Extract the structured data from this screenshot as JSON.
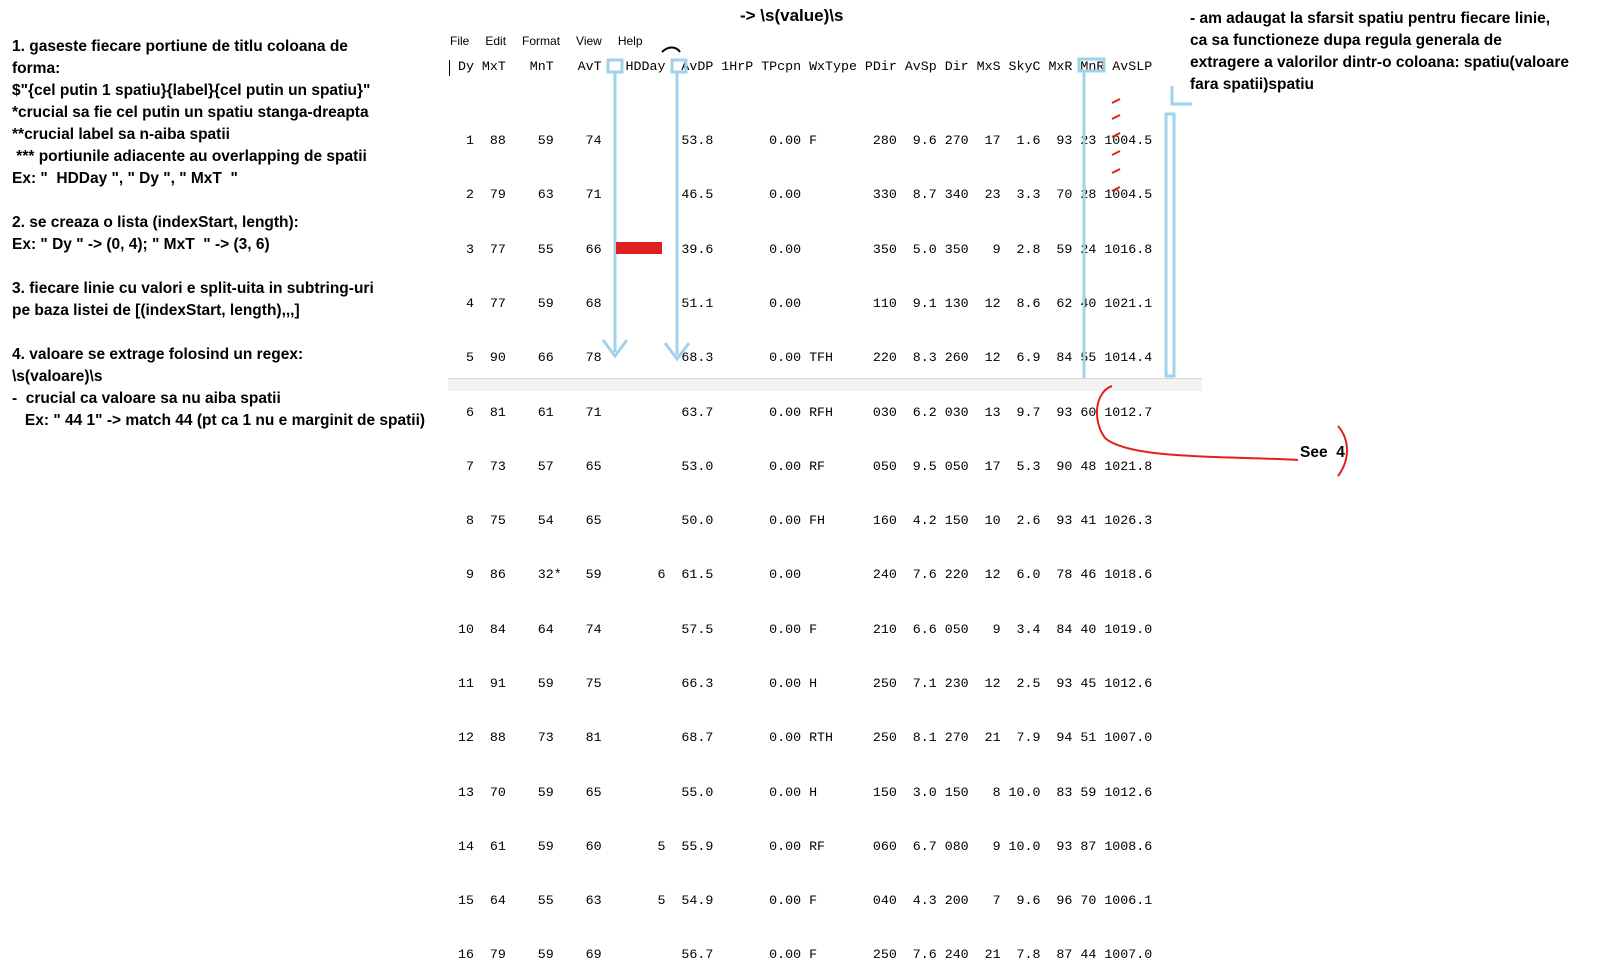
{
  "title_top": "-> \\s(value)\\s",
  "left_notes": [
    "1. gaseste fiecare portiune de titlu coloana de",
    "forma:",
    "$\"{cel putin 1 spatiu}{label}{cel putin un spatiu}\"",
    "*crucial sa fie cel putin un spatiu stanga-dreapta",
    "**crucial label sa n-aiba spatii",
    " *** portiunile adiacente au overlapping de spatii",
    "Ex: \"  HDDay \", \" Dy \", \" MxT  \"",
    "",
    "2. se creaza o lista (indexStart, length):",
    "Ex: \" Dy \" -> (0, 4); \" MxT  \" -> (3, 6)",
    "",
    "3. fiecare linie cu valori e split-uita in subtring-uri",
    "pe baza listei de [(indexStart, length),,,]",
    "",
    "4. valoare se extrage folosind un regex:",
    "\\s(valoare)\\s",
    "-  crucial ca valoare sa nu aiba spatii",
    "   Ex: \" 44 1\" -> match 44 (pt ca 1 nu e marginit de spatii)"
  ],
  "right_note": " - am adaugat la sfarsit spatiu pentru fiecare linie, ca sa functioneze dupa regula generala de extragere a valorilor dintr-o coloana: spatiu(valoare fara spatii)spatiu",
  "see_label": "See  4",
  "menu": [
    "File",
    "Edit",
    "Format",
    "View",
    "Help"
  ],
  "header_line": " Dy MxT   MnT   AvT   HDDay  AvDP 1HrP TPcpn WxType PDir AvSp Dir MxS SkyC MxR MnR AvSLP",
  "rows": [
    "  1  88    59    74          53.8       0.00 F       280  9.6 270  17  1.6  93 23 1004.5",
    "  2  79    63    71          46.5       0.00         330  8.7 340  23  3.3  70 28 1004.5",
    "  3  77    55    66          39.6       0.00         350  5.0 350   9  2.8  59 24 1016.8",
    "  4  77    59    68          51.1       0.00         110  9.1 130  12  8.6  62 40 1021.1",
    "  5  90    66    78          68.3       0.00 TFH     220  8.3 260  12  6.9  84 55 1014.4",
    "  6  81    61    71          63.7       0.00 RFH     030  6.2 030  13  9.7  93 60 1012.7",
    "  7  73    57    65          53.0       0.00 RF      050  9.5 050  17  5.3  90 48 1021.8",
    "  8  75    54    65          50.0       0.00 FH      160  4.2 150  10  2.6  93 41 1026.3",
    "  9  86    32*   59       6  61.5       0.00         240  7.6 220  12  6.0  78 46 1018.6",
    " 10  84    64    74          57.5       0.00 F       210  6.6 050   9  3.4  84 40 1019.0",
    " 11  91    59    75          66.3       0.00 H       250  7.1 230  12  2.5  93 45 1012.6",
    " 12  88    73    81          68.7       0.00 RTH     250  8.1 270  21  7.9  94 51 1007.0",
    " 13  70    59    65          55.0       0.00 H       150  3.0 150   8 10.0  83 59 1012.6",
    " 14  61    59    60       5  55.9       0.00 RF      060  6.7 080   9 10.0  93 87 1008.6",
    " 15  64    55    63       5  54.9       0.00 F       040  4.3 200   7  9.6  96 70 1006.1",
    " 16  79    59    69          56.7       0.00 F       250  7.6 240  21  7.8  87 44 1007.0"
  ],
  "colors": {
    "annotation_blue": "#9fd3ea",
    "annotation_red": "#e02020"
  }
}
